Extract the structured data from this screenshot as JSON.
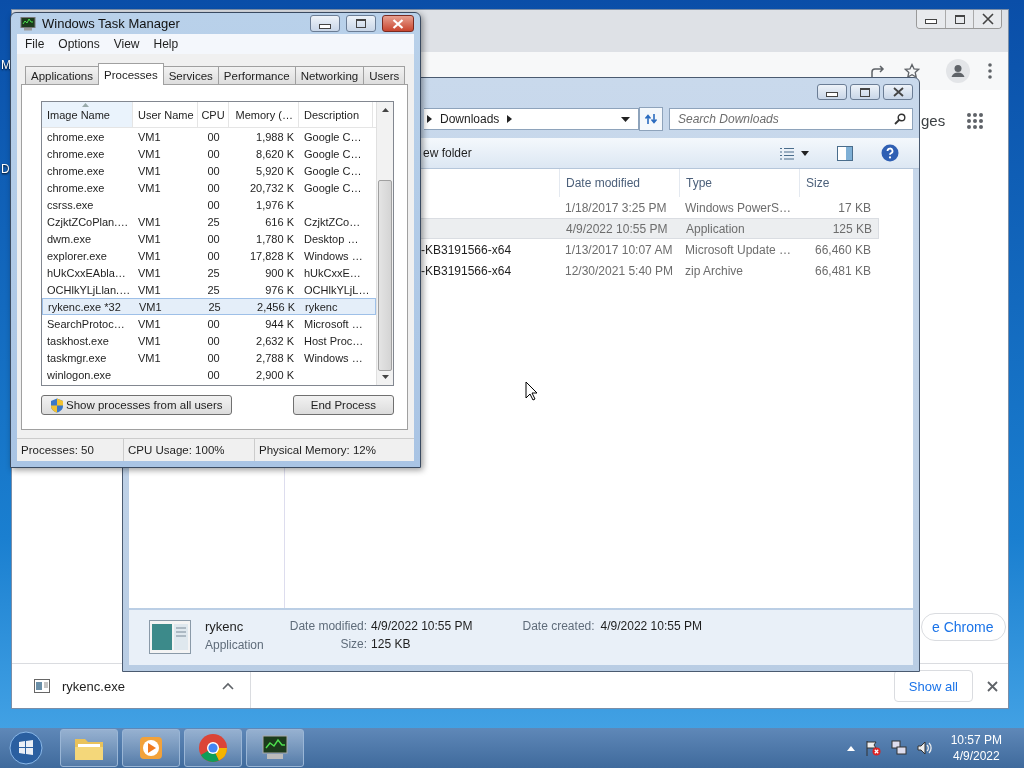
{
  "desktop": {
    "icon_labels": [
      "M",
      "D"
    ]
  },
  "browser": {
    "partial_link": "ges",
    "partial_button": "e Chrome",
    "downloads_bar": {
      "file": "rykenc.exe",
      "show_all": "Show all"
    }
  },
  "explorer": {
    "address": "Downloads",
    "search_placeholder": "Search Downloads",
    "command": "ew folder",
    "columns": [
      "Date modified",
      "Type",
      "Size"
    ],
    "rows": [
      {
        "date": "1/18/2017 3:25 PM",
        "type": "Windows PowerS…",
        "size": "17 KB",
        "selected": false
      },
      {
        "date": "4/9/2022 10:55 PM",
        "type": "Application",
        "size": "125 KB",
        "selected": true
      },
      {
        "name": "-KB3191566-x64",
        "date": "1/13/2017 10:07 AM",
        "type": "Microsoft Update …",
        "size": "66,460 KB",
        "selected": false
      },
      {
        "name": "-KB3191566-x64",
        "date": "12/30/2021 5:40 PM",
        "type": "zip Archive",
        "size": "66,481 KB",
        "selected": false
      }
    ],
    "details": {
      "name": "rykenc",
      "type": "Application",
      "modified_label": "Date modified:",
      "modified": "4/9/2022 10:55 PM",
      "size_label": "Size:",
      "size": "125 KB",
      "created_label": "Date created:",
      "created": "4/9/2022 10:55 PM"
    }
  },
  "task_manager": {
    "title": "Windows Task Manager",
    "menu": [
      "File",
      "Options",
      "View",
      "Help"
    ],
    "tabs": [
      {
        "label": "Applications",
        "selected": false
      },
      {
        "label": "Processes",
        "selected": true
      },
      {
        "label": "Services",
        "selected": false
      },
      {
        "label": "Performance",
        "selected": false
      },
      {
        "label": "Networking",
        "selected": false
      },
      {
        "label": "Users",
        "selected": false
      }
    ],
    "columns": [
      "Image Name",
      "User Name",
      "CPU",
      "Memory (…",
      "Description"
    ],
    "rows": [
      {
        "image": "chrome.exe",
        "user": "VM1",
        "cpu": "00",
        "memory": "1,988 K",
        "description": "Google C…",
        "selected": false
      },
      {
        "image": "chrome.exe",
        "user": "VM1",
        "cpu": "00",
        "memory": "8,620 K",
        "description": "Google C…",
        "selected": false
      },
      {
        "image": "chrome.exe",
        "user": "VM1",
        "cpu": "00",
        "memory": "5,920 K",
        "description": "Google C…",
        "selected": false
      },
      {
        "image": "chrome.exe",
        "user": "VM1",
        "cpu": "00",
        "memory": "20,732 K",
        "description": "Google C…",
        "selected": false
      },
      {
        "image": "csrss.exe",
        "cpu": "00",
        "memory": "1,976 K",
        "selected": false
      },
      {
        "image": "CzjktZCoPlan.…",
        "user": "VM1",
        "cpu": "25",
        "memory": "616 K",
        "description": "CzjktZCo…",
        "selected": false
      },
      {
        "image": "dwm.exe",
        "user": "VM1",
        "cpu": "00",
        "memory": "1,780 K",
        "description": "Desktop …",
        "selected": false
      },
      {
        "image": "explorer.exe",
        "user": "VM1",
        "cpu": "00",
        "memory": "17,828 K",
        "description": "Windows …",
        "selected": false
      },
      {
        "image": "hUkCxxEAbla…",
        "user": "VM1",
        "cpu": "25",
        "memory": "900 K",
        "description": "hUkCxxE…",
        "selected": false
      },
      {
        "image": "OCHlkYLjLlan.…",
        "user": "VM1",
        "cpu": "25",
        "memory": "976 K",
        "description": "OCHlkYLjL…",
        "selected": false
      },
      {
        "image": "rykenc.exe *32",
        "user": "VM1",
        "cpu": "25",
        "memory": "2,456 K",
        "description": "rykenc",
        "selected": true
      },
      {
        "image": "SearchProtoc…",
        "user": "VM1",
        "cpu": "00",
        "memory": "944 K",
        "description": "Microsoft …",
        "selected": false
      },
      {
        "image": "taskhost.exe",
        "user": "VM1",
        "cpu": "00",
        "memory": "2,632 K",
        "description": "Host Proc…",
        "selected": false
      },
      {
        "image": "taskmgr.exe",
        "user": "VM1",
        "cpu": "00",
        "memory": "2,788 K",
        "description": "Windows …",
        "selected": false
      },
      {
        "image": "winlogon.exe",
        "cpu": "00",
        "memory": "2,900 K",
        "selected": false
      }
    ],
    "buttons": [
      "Show processes from all users",
      "End Process"
    ],
    "status": [
      "Processes: 50",
      "CPU Usage: 100%",
      "Physical Memory: 12%"
    ]
  },
  "taskbar": {
    "apps": [
      {
        "kind": "folder"
      },
      {
        "kind": "media"
      },
      {
        "kind": "chrome"
      },
      {
        "kind": "monitor"
      }
    ],
    "time": "10:57 PM",
    "date": "4/9/2022"
  }
}
